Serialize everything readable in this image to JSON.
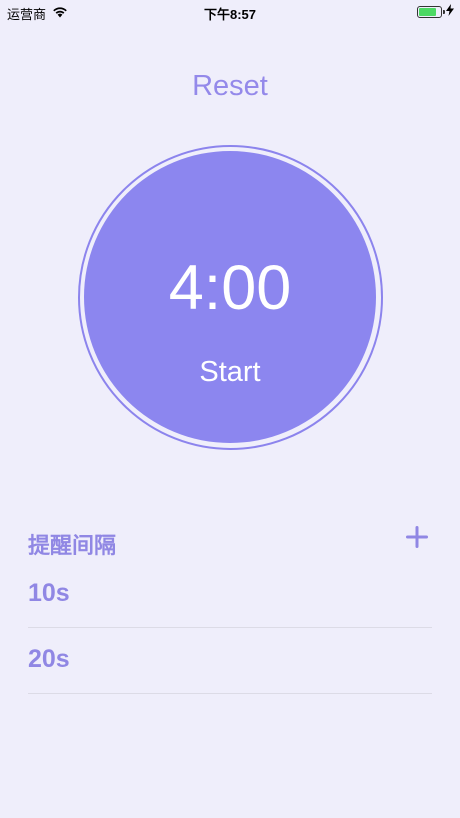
{
  "status_bar": {
    "carrier": "运营商",
    "time": "下午8:57",
    "battery_level": 0.8
  },
  "reset_label": "Reset",
  "timer": {
    "time": "4:00",
    "start_label": "Start"
  },
  "interval_section": {
    "title": "提醒间隔",
    "items": [
      {
        "label": "10s"
      },
      {
        "label": "20s"
      }
    ]
  },
  "colors": {
    "accent": "#8c86ef",
    "text_accent": "#9087e4",
    "background": "#efeefb"
  },
  "icons": [
    "wifi-icon",
    "battery-icon",
    "charging-bolt-icon",
    "plus-icon"
  ]
}
